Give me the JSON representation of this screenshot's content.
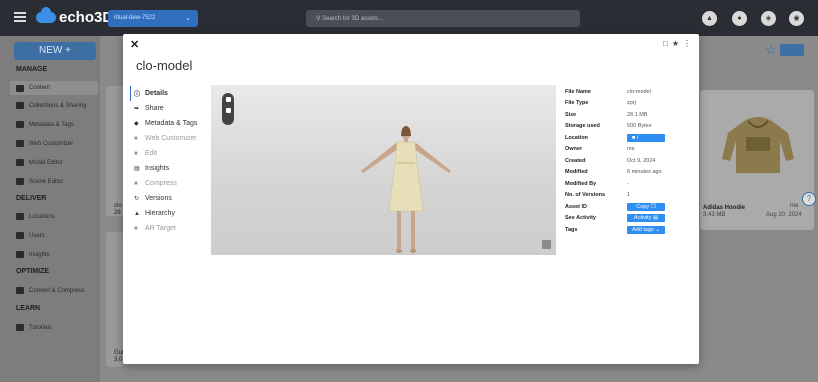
{
  "topbar": {
    "brand": "echo3D",
    "key_label": "ritual-dew-7522",
    "search_placeholder": "Search for 3D assets..."
  },
  "sidebar": {
    "new_label": "NEW +",
    "manage_header": "MANAGE",
    "manage_items": [
      "Content",
      "Collections & Sharing",
      "Metadata & Tags",
      "Web Customizer",
      "Model Editor",
      "Scene Editor"
    ],
    "deliver_header": "DELIVER",
    "deliver_items": [
      "Locations",
      "Users",
      "Insights"
    ],
    "optimize_header": "OPTIMIZE",
    "optimize_items": [
      "Convert & Compress"
    ],
    "learn_header": "LEARN",
    "learn_items": [
      "Tutorials"
    ]
  },
  "background": {
    "card_title": "Adidas Hoodie",
    "card_size": "3.43 MB",
    "card_date": "Aug 20, 2024",
    "card_owner": "me",
    "left_card_title": "clo",
    "left_card_size": "28",
    "bottom_card_title": "Gui",
    "bottom_card_size": "3.0"
  },
  "modal": {
    "title": "clo-model",
    "nav": [
      {
        "label": "Details",
        "icon": "info-icon",
        "state": "active"
      },
      {
        "label": "Share",
        "icon": "share-icon",
        "state": "normal"
      },
      {
        "label": "Metadata & Tags",
        "icon": "tag-icon",
        "state": "normal"
      },
      {
        "label": "Web Customizer",
        "icon": "lock-icon",
        "state": "disabled"
      },
      {
        "label": "Edit",
        "icon": "lock-icon",
        "state": "disabled"
      },
      {
        "label": "Insights",
        "icon": "chart-icon",
        "state": "normal"
      },
      {
        "label": "Compress",
        "icon": "lock-icon",
        "state": "disabled"
      },
      {
        "label": "Versions",
        "icon": "history-icon",
        "state": "normal"
      },
      {
        "label": "Hierarchy",
        "icon": "hierarchy-icon",
        "state": "normal"
      },
      {
        "label": "AR Target",
        "icon": "lock-icon",
        "state": "disabled"
      }
    ],
    "details": {
      "file_name_label": "File Name",
      "file_name": "clo-model",
      "file_type_label": "File Type",
      "file_type": "zprj",
      "size_label": "Size",
      "size": "28.1 MB",
      "storage_label": "Storage used",
      "storage": "500 Bytes",
      "location_label": "Location",
      "location": "/",
      "owner_label": "Owner",
      "owner": "me",
      "created_label": "Created",
      "created": "Oct 9, 2024",
      "modified_label": "Modified",
      "modified": "6 minutes ago",
      "modified_by_label": "Modified By",
      "modified_by": "-",
      "versions_label": "No. of Versions",
      "versions": "1",
      "asset_id_label": "Asset ID",
      "asset_id_button": "Copy",
      "activity_label": "See Activity",
      "activity_button": "Activity",
      "tags_label": "Tags",
      "tags_button": "Add tags"
    }
  },
  "colors": {
    "accent": "#2f8ef0",
    "topbar_bg": "#2a2e34"
  }
}
